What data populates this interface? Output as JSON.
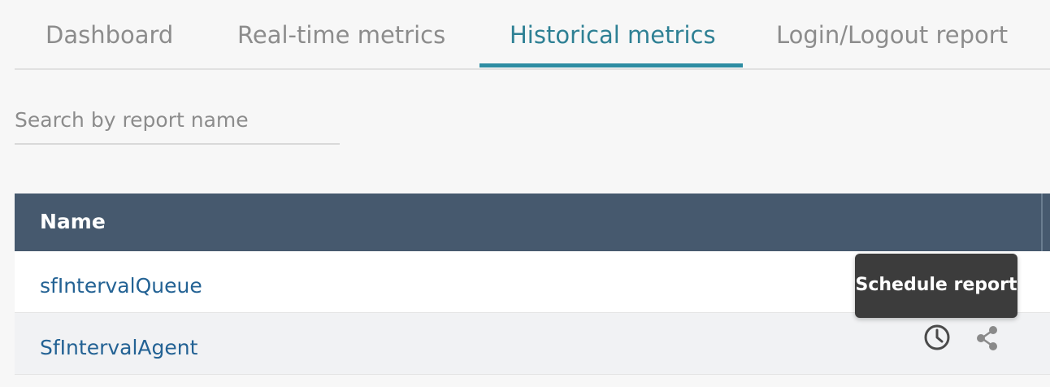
{
  "tabs": [
    {
      "label": "Dashboard",
      "active": false
    },
    {
      "label": "Real-time metrics",
      "active": false
    },
    {
      "label": "Historical metrics",
      "active": true
    },
    {
      "label": "Login/Logout report",
      "active": false
    }
  ],
  "search": {
    "placeholder": "Search by report name",
    "value": ""
  },
  "table": {
    "header": {
      "name": "Name"
    },
    "rows": [
      {
        "name": "sfIntervalQueue"
      },
      {
        "name": "SfIntervalAgent"
      }
    ]
  },
  "row_actions": {
    "schedule_icon": "clock-icon",
    "share_icon": "share-icon"
  },
  "tooltip": {
    "text": "Schedule report"
  },
  "colors": {
    "accent": "#2e8da3",
    "header_bg": "#46596e",
    "link": "#236294",
    "tooltip_bg": "#3c3c3c"
  }
}
